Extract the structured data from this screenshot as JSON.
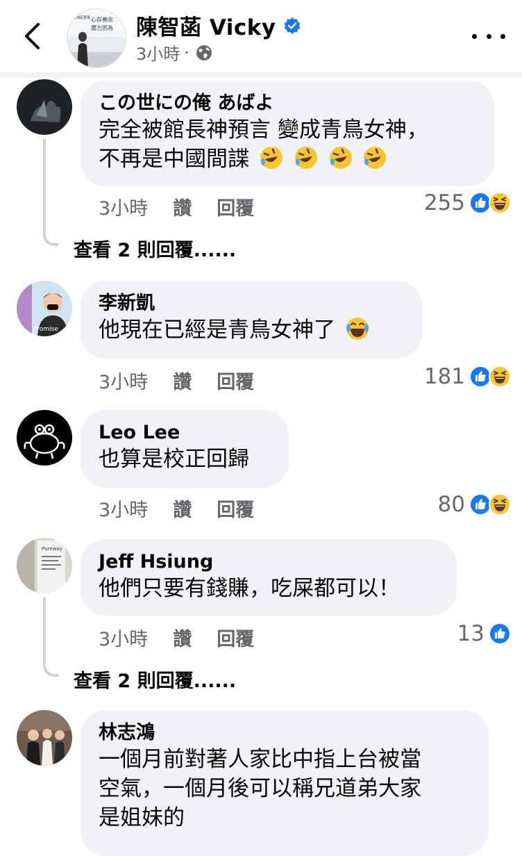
{
  "header": {
    "page_name": "陳智菡 Vicky",
    "post_time": "3小時",
    "separator": "·",
    "avatar_sign_line1": "心存善念",
    "avatar_sign_line2": "盡力而為",
    "avatar_sign_side": "台灣民眾黨"
  },
  "comments": [
    {
      "author": "この世にの俺 あばよ",
      "lines": [
        "完全被館長神預言 變成青鳥女神，",
        "不再是中國間諜"
      ],
      "time": "3小時",
      "like": "讚",
      "reply": "回覆",
      "count": "255",
      "replies_label": "查看 2 則回覆......"
    },
    {
      "author": "李新凱",
      "lines": [
        "他現在已經是青鳥女神了"
      ],
      "time": "3小時",
      "like": "讚",
      "reply": "回覆",
      "count": "181",
      "avatar_text": "Promise"
    },
    {
      "author": "Leo Lee",
      "lines": [
        "也算是校正回歸"
      ],
      "time": "3小時",
      "like": "讚",
      "reply": "回覆",
      "count": "80"
    },
    {
      "author": "Jeff Hsiung",
      "lines": [
        "他們只要有錢賺，吃屎都可以！"
      ],
      "time": "3小時",
      "like": "讚",
      "reply": "回覆",
      "count": "13",
      "replies_label": "查看 2 則回覆......",
      "avatar_text": "Pureway"
    },
    {
      "author": "林志鴻",
      "lines": [
        "一個月前對著人家比中指上台被當",
        "空氣，一個月後可以稱兄道弟大家",
        "是姐妹的"
      ]
    }
  ],
  "colors": {
    "like_blue": "#1877f2",
    "bubble": "#f0f2f5",
    "meta": "#65676b"
  }
}
